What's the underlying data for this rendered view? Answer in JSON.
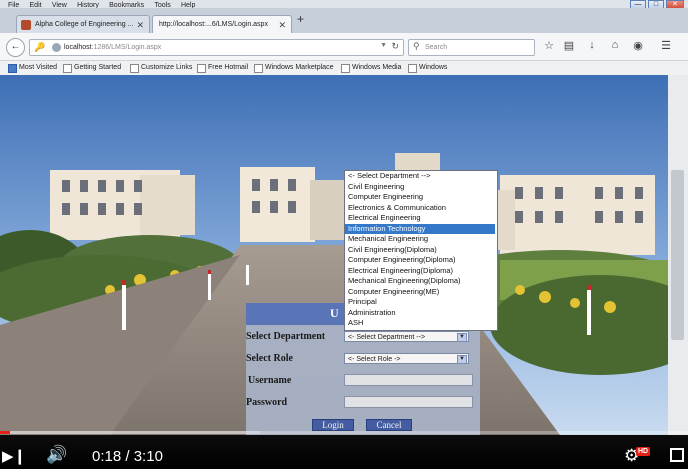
{
  "menu": [
    "File",
    "Edit",
    "View",
    "History",
    "Bookmarks",
    "Tools",
    "Help"
  ],
  "tabs": [
    {
      "title": "Alpha College of Engineering ...",
      "active": false
    },
    {
      "title": "http://localhost:...6/LMS/Login.aspx",
      "active": true
    }
  ],
  "new_tab_label": "+",
  "address": {
    "host": "localhost",
    "rest": ":1286/LMS/Login.aspx"
  },
  "search": {
    "placeholder": "Search"
  },
  "bookmarks": [
    "Most Visited",
    "Getting Started",
    "Customize Links",
    "Free Hotmail",
    "Windows Marketplace",
    "Windows Media",
    "Windows"
  ],
  "login": {
    "header_visible": "U",
    "department_label": "Select Department",
    "department_value": "<- Select Department -->",
    "role_label": "Select Role",
    "role_value": "<- Select Role ->",
    "username_label": "Username",
    "password_label": "Password",
    "login_button": "Login",
    "cancel_button": "Cancel"
  },
  "department_options": [
    "<- Select Department -->",
    "Civil Engineering",
    "Computer Engineering",
    "Electronics & Communication",
    "Electrical Engineering",
    "Information Technology",
    "Mechanical Engineering",
    "Civil Engineering(Diploma)",
    "Computer Engineering(Diploma)",
    "Electrical Engineering(Diploma)",
    "Mechanical Engineering(Diploma)",
    "Computer Engineering(ME)",
    "Principal",
    "Administration",
    "ASH"
  ],
  "highlighted_option": "Information Technology",
  "video": {
    "current_time": "0:18",
    "separator": "/",
    "duration": "3:10",
    "hd_badge": "HD",
    "progress_fraction": 0.095
  },
  "colors": {
    "accent": "#3478c9",
    "login_header": "#5a74b8",
    "progress": "#e62117"
  }
}
